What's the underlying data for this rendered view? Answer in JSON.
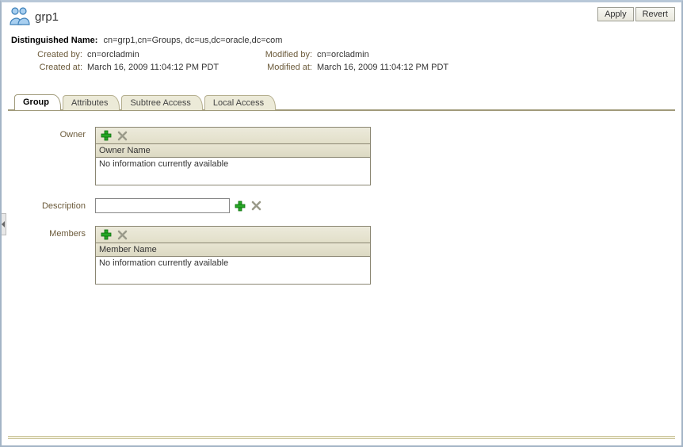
{
  "header": {
    "title": "grp1",
    "apply_label": "Apply",
    "revert_label": "Revert"
  },
  "dn": {
    "label": "Distinguished Name:",
    "value": "cn=grp1,cn=Groups, dc=us,dc=oracle,dc=com"
  },
  "meta": {
    "created_by_label": "Created by:",
    "created_by_value": "cn=orcladmin",
    "created_at_label": "Created at:",
    "created_at_value": "March 16, 2009 11:04:12 PM PDT",
    "modified_by_label": "Modified by:",
    "modified_by_value": "cn=orcladmin",
    "modified_at_label": "Modified at:",
    "modified_at_value": "March 16, 2009 11:04:12 PM PDT"
  },
  "tabs": {
    "group": "Group",
    "attributes": "Attributes",
    "subtree": "Subtree Access",
    "local": "Local Access"
  },
  "fields": {
    "owner_label": "Owner",
    "owner_header": "Owner Name",
    "owner_empty": "No information currently available",
    "description_label": "Description",
    "description_value": "",
    "members_label": "Members",
    "members_header": "Member Name",
    "members_empty": "No information currently available"
  }
}
